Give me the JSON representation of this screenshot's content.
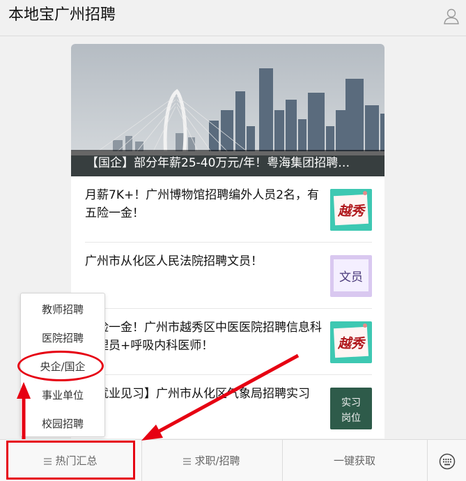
{
  "header": {
    "title": "本地宝广州招聘",
    "profile_icon": "user-icon"
  },
  "banner": {
    "caption": "【国企】部分年薪25-40万元/年！粤海集团招聘…"
  },
  "articles": [
    {
      "text": "月薪7K+！广州博物馆招聘编外人员2名，有五险一金！",
      "thumb_text": "越秀",
      "thumb_bg": "#3ec8b2"
    },
    {
      "text": "广州市从化区人民法院招聘文员！",
      "thumb_text": "文员",
      "thumb_bg": "#d9c8f0"
    },
    {
      "text": "五险一金！广州市越秀区中医医院招聘信息科管理员+呼吸内科医师！",
      "thumb_text": "越秀",
      "thumb_bg": "#3ec8b2"
    },
    {
      "text": "【就业见习】广州市从化区气象局招聘实习",
      "thumb_text": "实习岗位",
      "thumb_bg": "#2e5b4a"
    }
  ],
  "popup_menu": {
    "items": [
      "教师招聘",
      "医院招聘",
      "央企/国企",
      "事业单位",
      "校园招聘"
    ]
  },
  "bottom_bar": {
    "tabs": [
      "热门汇总",
      "求职/招聘",
      "一键获取"
    ],
    "keyboard_icon": "keyboard-icon"
  },
  "colors": {
    "annotation_red": "#e60012",
    "teal_thumb": "#3ec8b2",
    "background": "#f1f1f1"
  }
}
